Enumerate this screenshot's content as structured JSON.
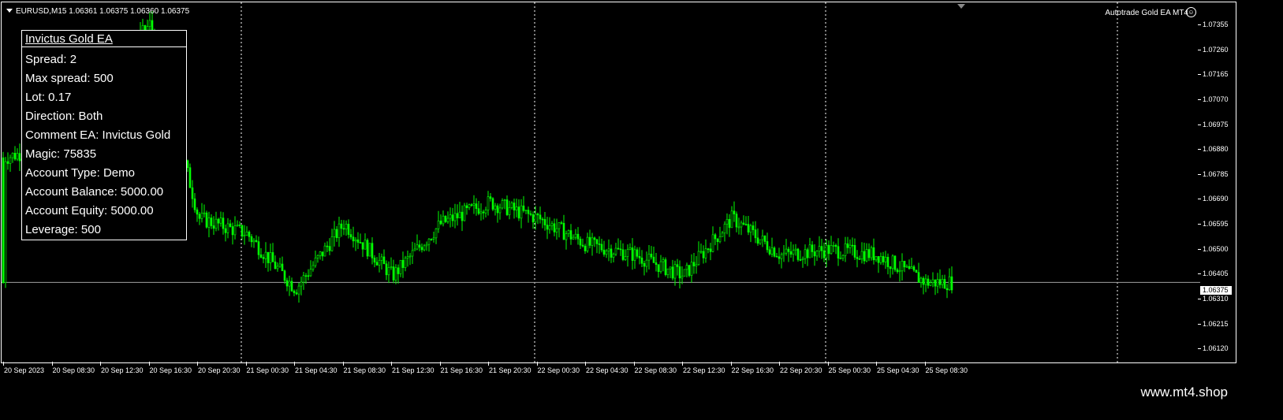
{
  "header": {
    "symbol_info": "EURUSD,M15  1.06361 1.06375 1.06360 1.06375",
    "ea_name": "Autotrade Gold EA MT4",
    "smiley_icon": "☺"
  },
  "info_panel": {
    "title": "Invictus Gold EA",
    "lines": [
      "Spread: 2",
      "Max spread: 500",
      "Lot: 0.17",
      "Direction: Both",
      "Comment EA: Invictus Gold",
      "Magic: 75835",
      "Account Type: Demo",
      "Account Balance: 5000.00",
      "Account Equity: 5000.00",
      "Leverage: 500"
    ]
  },
  "price_axis": {
    "labels": [
      "1.07355",
      "1.07260",
      "1.07165",
      "1.07070",
      "1.06975",
      "1.06880",
      "1.06785",
      "1.06690",
      "1.06595",
      "1.06500",
      "1.06405",
      "1.06310",
      "1.06215",
      "1.06120"
    ],
    "current_price": "1.06375"
  },
  "time_axis": {
    "labels": [
      "20 Sep 2023",
      "20 Sep 08:30",
      "20 Sep 12:30",
      "20 Sep 16:30",
      "20 Sep 20:30",
      "21 Sep 00:30",
      "21 Sep 04:30",
      "21 Sep 08:30",
      "21 Sep 12:30",
      "21 Sep 16:30",
      "21 Sep 20:30",
      "22 Sep 00:30",
      "22 Sep 04:30",
      "22 Sep 08:30",
      "22 Sep 12:30",
      "22 Sep 16:30",
      "22 Sep 20:30",
      "25 Sep 00:30",
      "25 Sep 04:30",
      "25 Sep 08:30"
    ]
  },
  "colors": {
    "background": "#000000",
    "candle": "#00ff00",
    "grid": "#ffffff",
    "bid_line": "#a0a0a0"
  },
  "footer": {
    "watermark": "www.mt4.shop"
  },
  "chart_data": {
    "type": "candlestick",
    "symbol": "EURUSD",
    "timeframe": "M15",
    "ylim": [
      1.0612,
      1.074
    ],
    "y_ticks": [
      1.07355,
      1.0726,
      1.07165,
      1.0707,
      1.06975,
      1.0688,
      1.06785,
      1.0669,
      1.06595,
      1.065,
      1.06405,
      1.0631,
      1.06215,
      1.0612
    ],
    "current_price": 1.06375,
    "close_trace": [
      [
        "20 Sep 2023",
        1.0685
      ],
      [
        "20 Sep 08:30",
        1.069
      ],
      [
        "20 Sep 16:30",
        1.0736
      ],
      [
        "20 Sep 20:30",
        1.0662
      ],
      [
        "21 Sep 00:30",
        1.0656
      ],
      [
        "21 Sep 04:30",
        1.0635
      ],
      [
        "21 Sep 08:30",
        1.066
      ],
      [
        "21 Sep 12:30",
        1.064
      ],
      [
        "21 Sep 16:30",
        1.066
      ],
      [
        "21 Sep 20:30",
        1.0668
      ],
      [
        "22 Sep 00:30",
        1.0662
      ],
      [
        "22 Sep 04:30",
        1.0652
      ],
      [
        "22 Sep 08:30",
        1.0648
      ],
      [
        "22 Sep 12:30",
        1.064
      ],
      [
        "22 Sep 16:30",
        1.0662
      ],
      [
        "22 Sep 20:30",
        1.0648
      ],
      [
        "25 Sep 00:30",
        1.065
      ],
      [
        "25 Sep 04:30",
        1.0648
      ],
      [
        "25 Sep 08:30",
        1.06375
      ]
    ]
  }
}
